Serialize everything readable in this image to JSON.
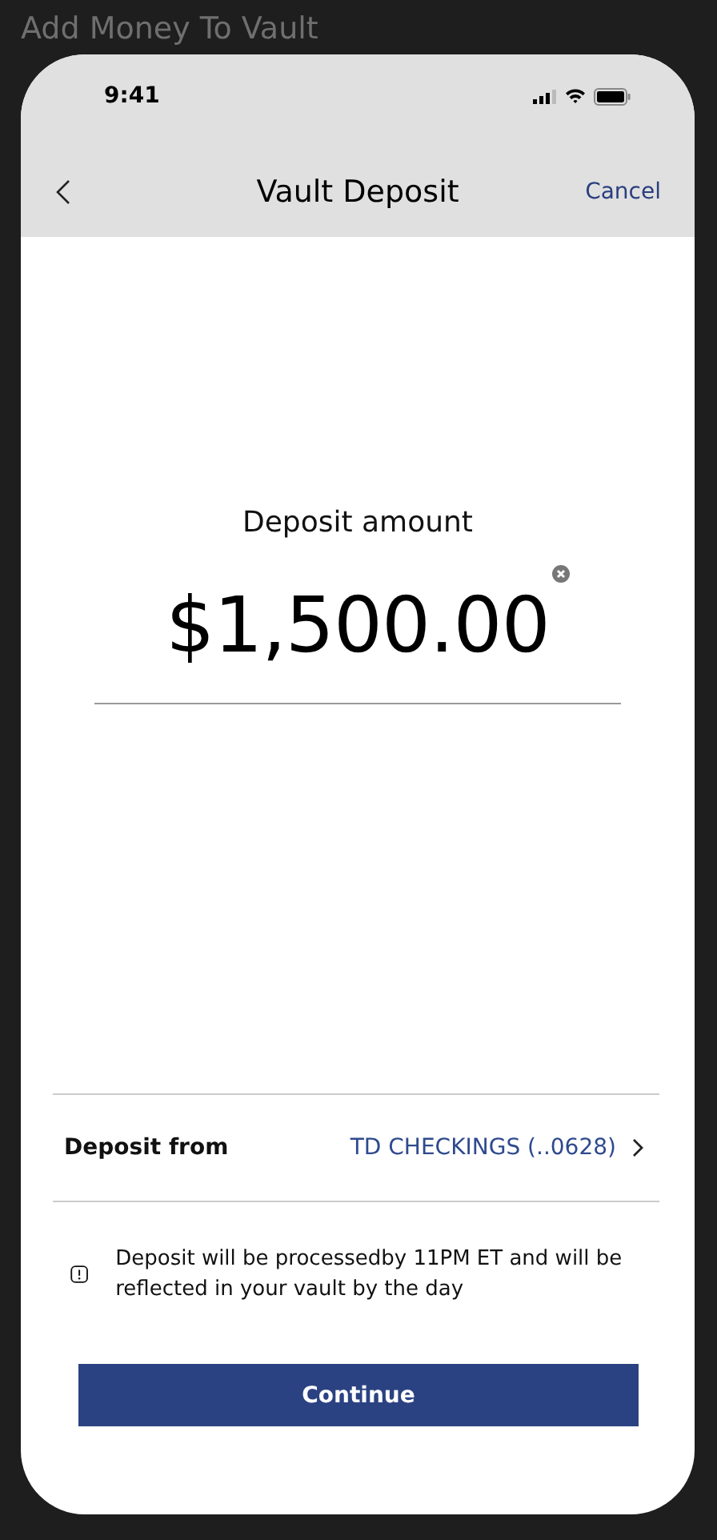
{
  "frame_title": "Add Money To Vault",
  "status_bar": {
    "time": "9:41"
  },
  "nav": {
    "title": "Vault Deposit",
    "cancel": "Cancel"
  },
  "amount": {
    "label": "Deposit amount",
    "value": "$1,500.00"
  },
  "deposit_from": {
    "label": "Deposit from",
    "account": "TD CHECKINGS (..0628)"
  },
  "notice": "Deposit will be processedby 11PM ET and will be reflected in your vault by the day",
  "button": "Continue"
}
